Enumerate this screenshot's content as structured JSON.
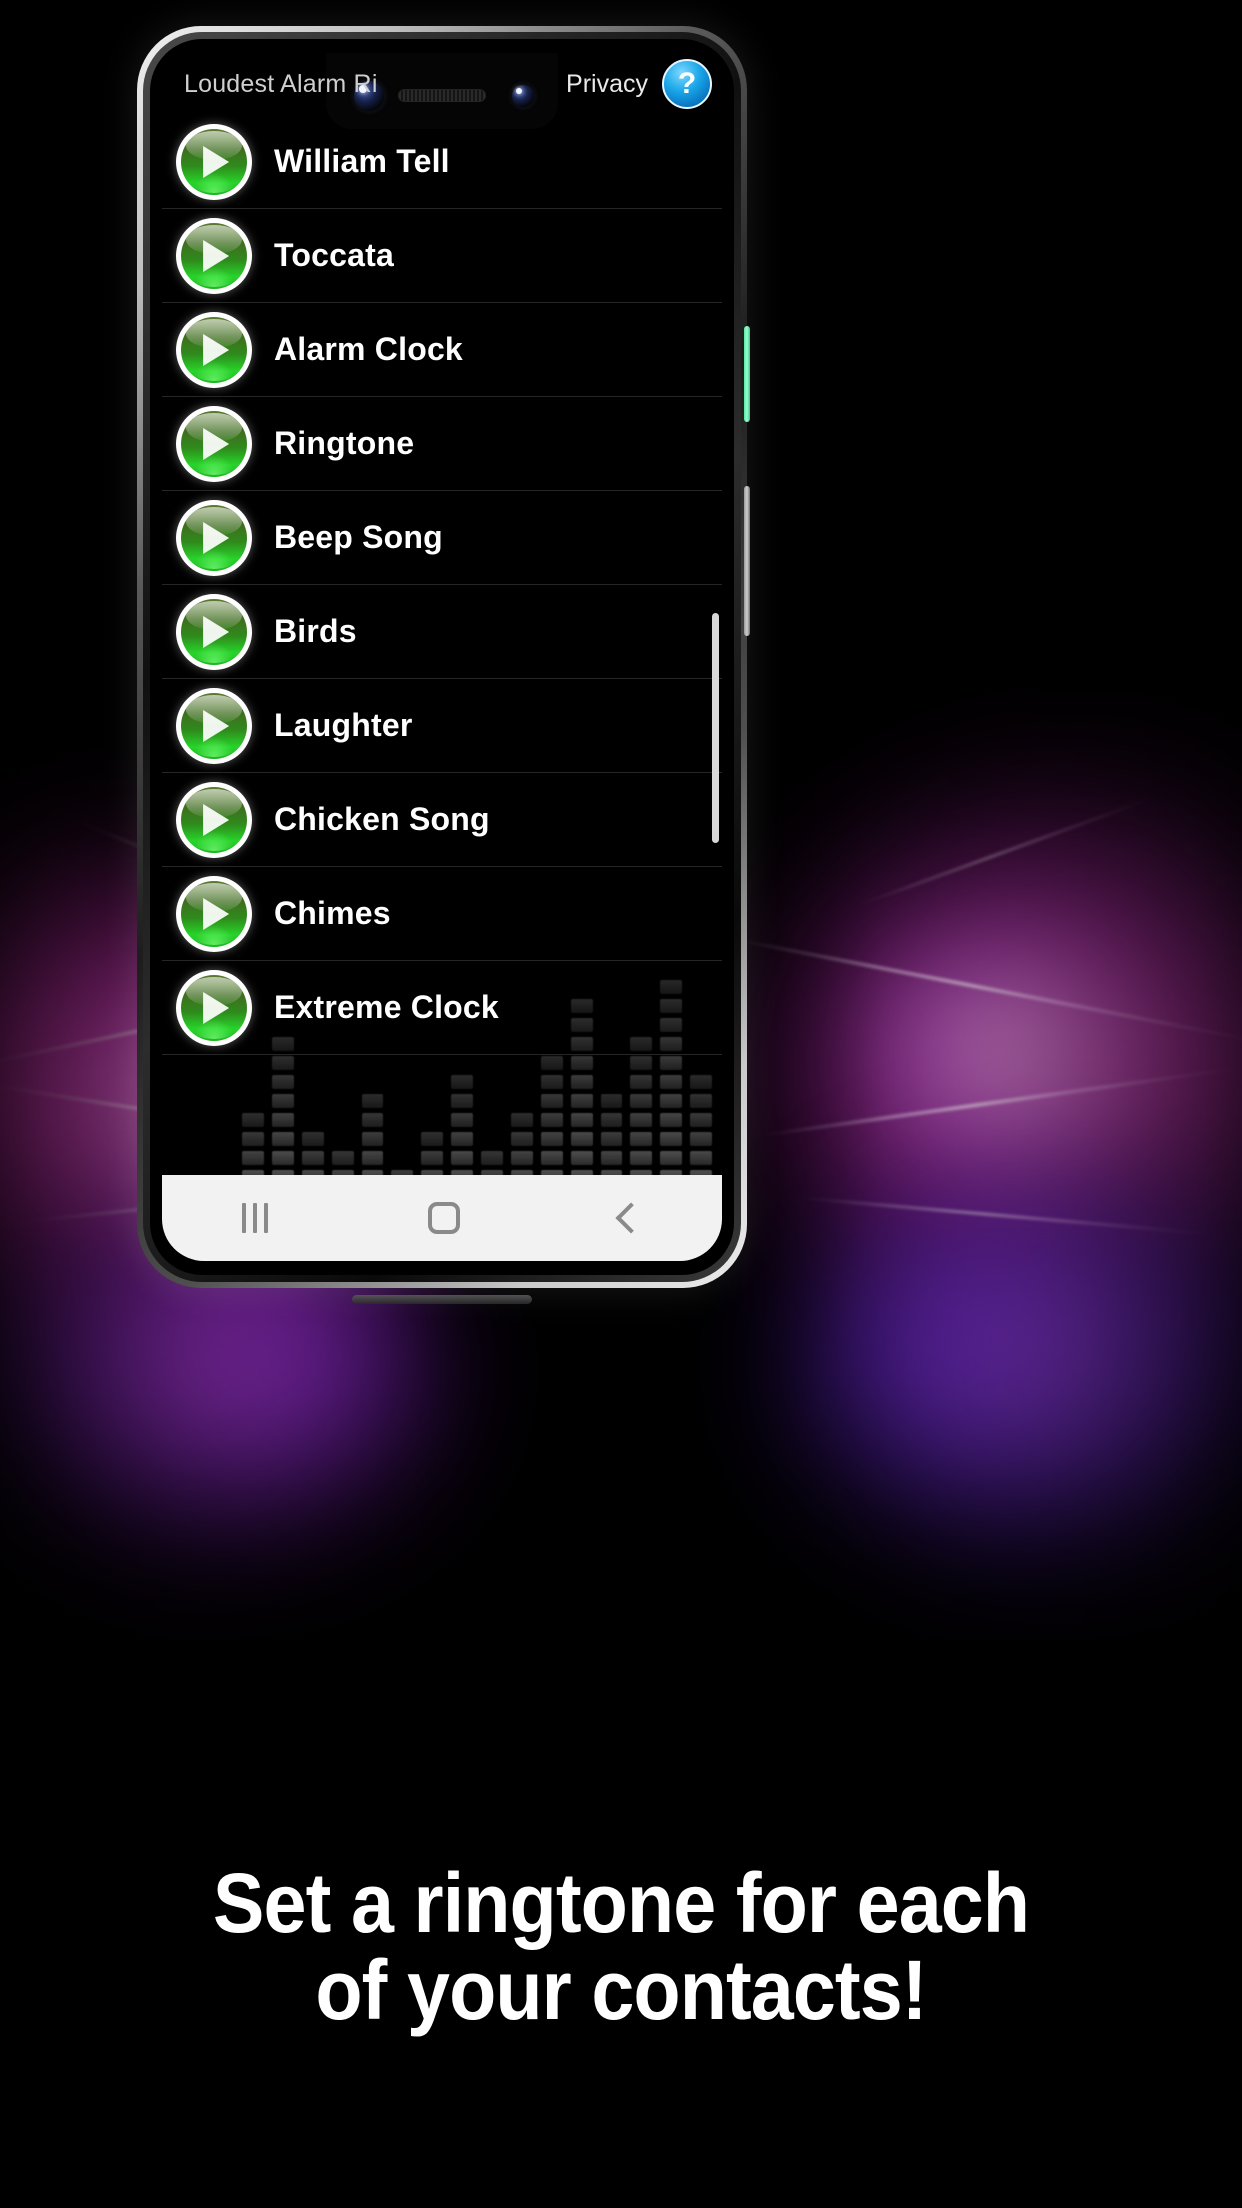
{
  "header": {
    "app_title": "Loudest Alarm Ri",
    "privacy_label": "Privacy",
    "help_label": "?"
  },
  "list": {
    "rows": [
      {
        "name": "William Tell",
        "icon": "play-icon"
      },
      {
        "name": "Toccata",
        "icon": "play-icon"
      },
      {
        "name": "Alarm Clock",
        "icon": "play-icon"
      },
      {
        "name": "Ringtone",
        "icon": "play-icon"
      },
      {
        "name": "Beep Song",
        "icon": "play-icon"
      },
      {
        "name": "Birds",
        "icon": "play-icon"
      },
      {
        "name": "Laughter",
        "icon": "play-icon"
      },
      {
        "name": "Chicken Song",
        "icon": "play-icon"
      },
      {
        "name": "Chimes",
        "icon": "play-icon"
      },
      {
        "name": "Extreme Clock",
        "icon": "play-icon"
      }
    ]
  },
  "navbar": {
    "recents_label": "recents-icon",
    "home_label": "home-icon",
    "back_label": "back-icon"
  },
  "caption": {
    "line1": "Set a ringtone for each",
    "line2": "of your contacts!"
  },
  "colors": {
    "accent_green": "#27d42a",
    "help_blue": "#19a6e8",
    "background": "#000000",
    "navbar": "#f2f2f2",
    "row_text": "#ffffff",
    "title_text": "#cfcfcf",
    "equalizer_bar": "#6e6e6e"
  },
  "equalizer": {
    "columns": [
      5,
      9,
      4,
      3,
      6,
      2,
      4,
      7,
      3,
      5,
      8,
      11,
      6,
      9,
      12,
      7
    ]
  }
}
